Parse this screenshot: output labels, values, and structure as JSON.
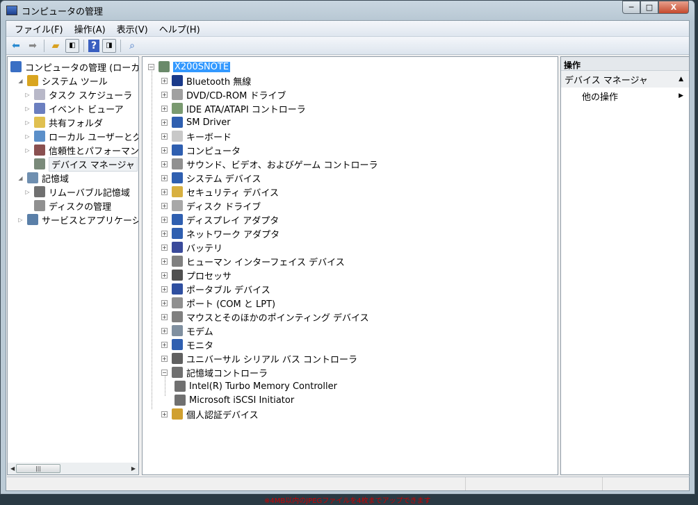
{
  "window": {
    "title": "コンピュータの管理",
    "min": "─",
    "max": "□",
    "close": "X"
  },
  "menu": [
    "ファイル(F)",
    "操作(A)",
    "表示(V)",
    "ヘルプ(H)"
  ],
  "left_tree": [
    {
      "label": "コンピュータの管理 (ローカル",
      "level": 0,
      "exp": "",
      "color": "#3a6fc4"
    },
    {
      "label": "システム ツール",
      "level": 1,
      "exp": "◢",
      "color": "#d9a520"
    },
    {
      "label": "タスク スケジューラ",
      "level": 2,
      "exp": "▷",
      "color": "#b8b8c8"
    },
    {
      "label": "イベント ビューア",
      "level": 2,
      "exp": "▷",
      "color": "#6b7fc0"
    },
    {
      "label": "共有フォルダ",
      "level": 2,
      "exp": "▷",
      "color": "#e0c050"
    },
    {
      "label": "ローカル ユーザーとグ",
      "level": 2,
      "exp": "▷",
      "color": "#5b8fc9"
    },
    {
      "label": "信頼性とパフォーマンス",
      "level": 2,
      "exp": "▷",
      "color": "#8a5050"
    },
    {
      "label": "デバイス マネージャ",
      "level": 2,
      "exp": "",
      "color": "#7a8a7a",
      "selected": true
    },
    {
      "label": "記憶域",
      "level": 1,
      "exp": "◢",
      "color": "#6f8fb0"
    },
    {
      "label": "リムーバブル記憶域",
      "level": 2,
      "exp": "▷",
      "color": "#707070"
    },
    {
      "label": "ディスクの管理",
      "level": 2,
      "exp": "",
      "color": "#909090"
    },
    {
      "label": "サービスとアプリケーショ",
      "level": 1,
      "exp": "▷",
      "color": "#5a7fa8"
    }
  ],
  "device_tree": {
    "root": "X200SNOTE",
    "items": [
      {
        "label": "Bluetooth 無線",
        "color": "#1a3a8a"
      },
      {
        "label": "DVD/CD-ROM ドライブ",
        "color": "#a0a0a0"
      },
      {
        "label": "IDE ATA/ATAPI コントローラ",
        "color": "#7a9a70"
      },
      {
        "label": "SM Driver",
        "color": "#2f5fb0"
      },
      {
        "label": "キーボード",
        "color": "#c8c8c8"
      },
      {
        "label": "コンピュータ",
        "color": "#2f5fb0"
      },
      {
        "label": "サウンド、ビデオ、およびゲーム コントローラ",
        "color": "#909090"
      },
      {
        "label": "システム デバイス",
        "color": "#2f5fb0"
      },
      {
        "label": "セキュリティ デバイス",
        "color": "#d8b040"
      },
      {
        "label": "ディスク ドライブ",
        "color": "#a8a8a8"
      },
      {
        "label": "ディスプレイ アダプタ",
        "color": "#2f5fb0"
      },
      {
        "label": "ネットワーク アダプタ",
        "color": "#2f5fb0"
      },
      {
        "label": "バッテリ",
        "color": "#3a4a9a"
      },
      {
        "label": "ヒューマン インターフェイス デバイス",
        "color": "#808080"
      },
      {
        "label": "プロセッサ",
        "color": "#505050"
      },
      {
        "label": "ポータブル デバイス",
        "color": "#2f4fa0"
      },
      {
        "label": "ポート (COM と LPT)",
        "color": "#909090"
      },
      {
        "label": "マウスとそのほかのポインティング デバイス",
        "color": "#808080"
      },
      {
        "label": "モデム",
        "color": "#8090a0"
      },
      {
        "label": "モニタ",
        "color": "#2f5fb0"
      },
      {
        "label": "ユニバーサル シリアル バス コントローラ",
        "color": "#606060"
      },
      {
        "label": "記憶域コントローラ",
        "color": "#707070",
        "expanded": true
      },
      {
        "label": "Intel(R) Turbo Memory Controller",
        "color": "#707070",
        "child": true
      },
      {
        "label": "Microsoft iSCSI Initiator",
        "color": "#707070",
        "child": true
      },
      {
        "label": "個人認証デバイス",
        "color": "#d0a030"
      }
    ]
  },
  "actions": {
    "header": "操作",
    "section": "デバイス マネージャ",
    "section_arrow": "▲",
    "more": "他の操作",
    "more_arrow": "▶"
  },
  "footer_note": "※4MB以内のJPEGファイルを4枚までアップできます"
}
